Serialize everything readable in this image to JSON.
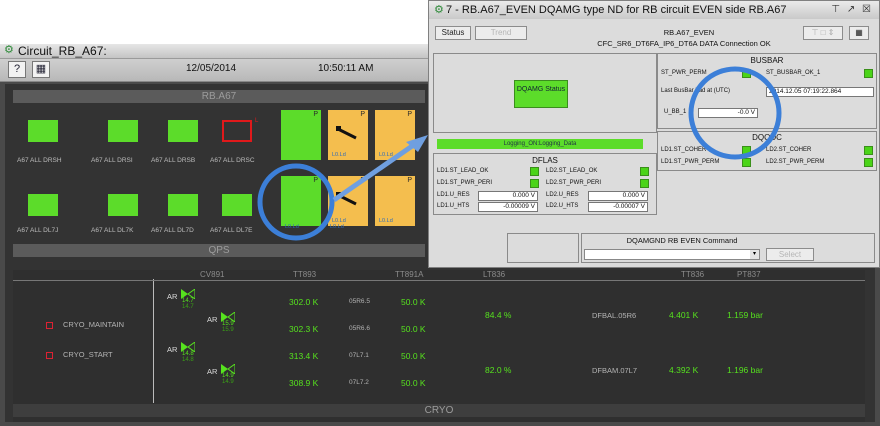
{
  "main": {
    "window_title": "Circuit_RB_A67:",
    "date": "12/05/2014",
    "time": "10:50:11 AM",
    "section_top": "RB.A67",
    "section_qps": "QPS",
    "section_cryo": "CRYO",
    "devices_row1": [
      "A67 ALL DRSH",
      "A67 ALL DRSI",
      "A67 ALL DRSB",
      "A67 ALL DRSC"
    ],
    "devices_row2": [
      "A67 ALL DL7J",
      "A67 ALL DL7K",
      "A67 ALL DL7D",
      "A67 ALL DL7E"
    ],
    "row1_last_tag": "L",
    "pc_tag": "P",
    "pc_label": "L0.Ld",
    "cryo": {
      "headers": [
        "CV891",
        "TT893",
        "TT891A",
        "LT836",
        "TT836",
        "PT837"
      ],
      "states": [
        "CRYO_MAINTAIN",
        "CRYO_START"
      ],
      "ar_label": "AR",
      "ar_values": [
        [
          "14.7",
          "14.7"
        ],
        [
          "15.9",
          "15.9"
        ],
        [
          "14.8",
          "14.8"
        ],
        [
          "14.9",
          "14.9"
        ]
      ],
      "tt893": [
        "302.0 K",
        "302.3 K",
        "313.4 K",
        "308.9 K"
      ],
      "tags": [
        "05R6.5",
        "05R6.6",
        "07L7.1",
        "07L7.2"
      ],
      "tt891a": [
        "50.0 K",
        "50.0 K",
        "50.0 K",
        "50.0 K"
      ],
      "lt836": [
        "84.4 %",
        "82.0 %"
      ],
      "dfb": [
        "DFBAL.05R6",
        "DFBAM.07L7"
      ],
      "tt836": [
        "4.401 K",
        "4.392 K"
      ],
      "pt837": [
        "1.159 bar",
        "1.196 bar"
      ]
    },
    "edge_left": "L",
    "edge_right": "A"
  },
  "popup": {
    "title": "7 - RB.A67_EVEN DQAMG type ND for RB circuit EVEN side RB.A67",
    "status_btn": "Status",
    "trend_btn": "Trend",
    "circuit": "RB.A67_EVEN",
    "connection": "CFC_SR6_DT6FA_IP6_DT6A DATA Connection OK",
    "dqamg_btn": "DQAMG Status",
    "logging": "Logging_ON:Logging_Data",
    "dflas": {
      "title": "DFLAS",
      "rows": [
        [
          "LD1.ST_LEAD_OK",
          "LD2.ST_LEAD_OK"
        ],
        [
          "LD1.ST_PWR_PERI",
          "LD2.ST_PWR_PERI"
        ]
      ],
      "u_res": [
        "LD1.U_RES",
        "0.000 V",
        "LD2.U_RES",
        "0.000 V"
      ],
      "u_ht": [
        "LD1.U_HTS",
        "-0.00009 V",
        "LD2.U_HTS",
        "-0.00007 V"
      ]
    },
    "busbar": {
      "title": "BUSBAR",
      "perm": "ST_PWR_PERM",
      "ok": "ST_BUSBAR_OK_1",
      "last_lbl": "Last BusBar bad at (UTC)",
      "last_val": "2014.12.05 07:19:22.864",
      "ubb_lbl": "U_BB_1",
      "ubb_val": "-0.0 V"
    },
    "dqqdc": {
      "title": "DQQDC",
      "rows": [
        [
          "LD1.ST_COHER",
          "LD2.ST_COHER"
        ],
        [
          "LD1.ST_PWR_PERM",
          "LD2.ST_PWR_PERM"
        ]
      ]
    },
    "cmd_title": "DQAMGND RB EVEN Command",
    "select_btn": "Select"
  },
  "colors": {
    "green": "#5cdc2a",
    "orange": "#f4be4e",
    "circle": "#3c7fd8",
    "text_green": "#56e21e"
  }
}
